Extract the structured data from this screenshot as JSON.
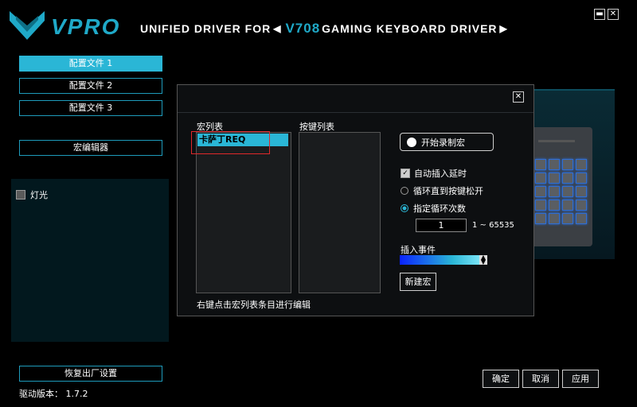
{
  "header": {
    "brand": "VPRO",
    "prefix": "UNIFIED DRIVER FOR",
    "model": "V708",
    "suffix": "GAMING KEYBOARD DRIVER",
    "arrow_left": "◀",
    "arrow_right": "▶",
    "minimize_label": "▬",
    "close_label": "✕"
  },
  "sidebar": {
    "profiles": [
      "配置文件 1",
      "配置文件 2",
      "配置文件 3"
    ],
    "active_profile": 0,
    "macro_editor": "宏编辑器",
    "lighting_label": "灯光",
    "restore_label": "恢复出厂设置",
    "version_label": "驱动版本： 1.7.2"
  },
  "dialog": {
    "close_label": "✕",
    "macro_list_label": "宏列表",
    "key_list_label": "按键列表",
    "macro_items": [
      "卡萨丁REQ"
    ],
    "hint": "右键点击宏列表条目进行编辑",
    "record_label": "开始录制宏",
    "auto_delay_label": "自动插入延时",
    "auto_delay_checked": true,
    "loop_release_label": "循环直到按键松开",
    "loop_count_label": "指定循环次数",
    "selected_loop_option": "指定循环次数",
    "loop_count_value": "1",
    "loop_range": "1 ~ 65535",
    "insert_event_label": "插入事件",
    "new_macro_label": "新建宏"
  },
  "footer": {
    "ok_label": "确定",
    "cancel_label": "取消",
    "apply_label": "应用"
  },
  "colors": {
    "accent": "#2ab6d6",
    "brand": "#1fa9c8",
    "highlight_box": "#e0282a",
    "key_glow": "#2e6ed6"
  }
}
